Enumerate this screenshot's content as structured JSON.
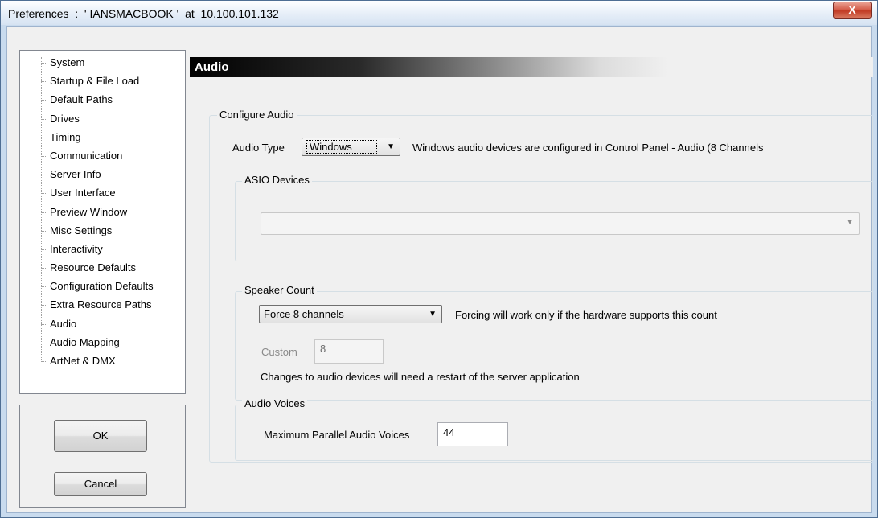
{
  "window": {
    "title": "Preferences  :  ' IANSMACBOOK '  at  10.100.101.132",
    "close_glyph": "X"
  },
  "tree": {
    "items": [
      "System",
      "Startup & File Load",
      "Default Paths",
      "Drives",
      "Timing",
      "Communication",
      "Server Info",
      "User Interface",
      "Preview Window",
      "Misc Settings",
      "Interactivity",
      "Resource Defaults",
      "Configuration Defaults",
      "Extra Resource Paths",
      "Audio",
      "Audio Mapping",
      "ArtNet & DMX"
    ],
    "selected": "Audio"
  },
  "buttons": {
    "ok": "OK",
    "cancel": "Cancel"
  },
  "panel": {
    "title": "Audio",
    "configure_group": "Configure Audio",
    "audio_type_label": "Audio Type",
    "audio_type_value": "Windows",
    "audio_type_note": "Windows audio devices are configured in Control Panel - Audio (8 Channels",
    "asio_group": "ASIO Devices",
    "asio_value": "",
    "speaker_group": "Speaker Count",
    "speaker_value": "Force 8 channels",
    "speaker_note": "Forcing will work only if the hardware supports this count",
    "custom_label": "Custom",
    "custom_value": "8",
    "restart_note": "Changes to audio devices will need a restart of the server application",
    "voices_group": "Audio Voices",
    "voices_label": "Maximum Parallel Audio Voices",
    "voices_value": "44"
  },
  "icons": {
    "dropdown": "chevron-down-icon",
    "close": "close-icon"
  }
}
